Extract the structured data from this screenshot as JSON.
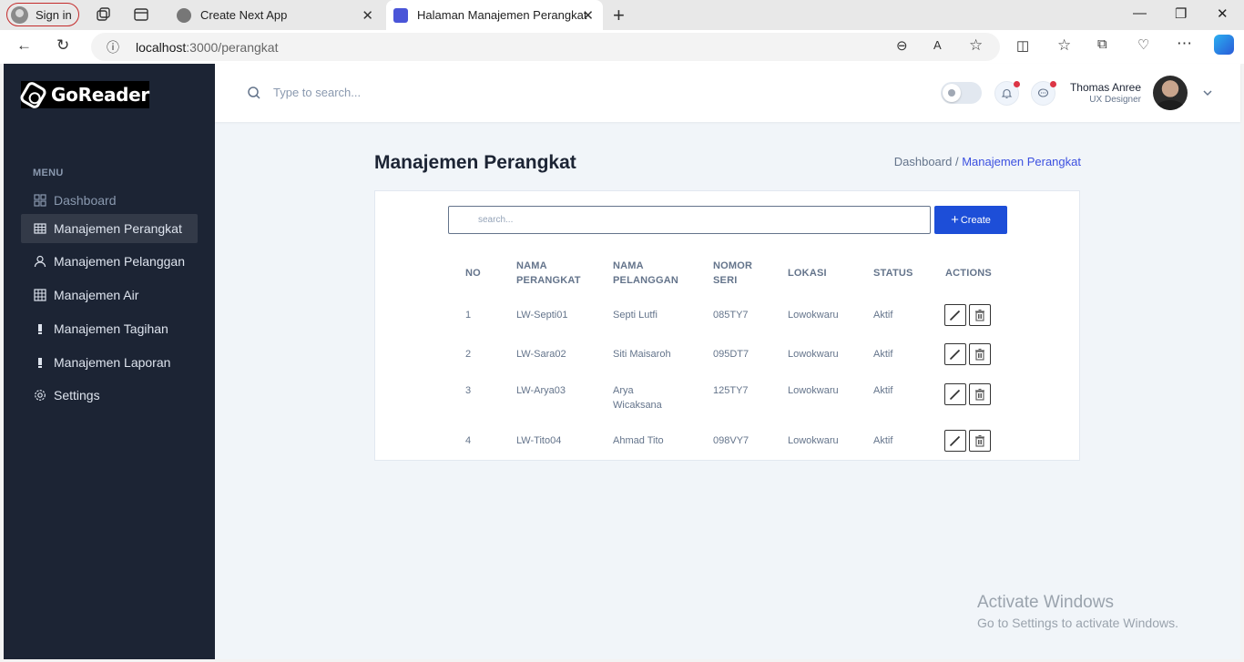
{
  "browser": {
    "signin_label": "Sign in",
    "tabs": [
      {
        "title": "Create Next App"
      },
      {
        "title": "Halaman Manajemen Perangkat"
      }
    ],
    "url_host": "localhost",
    "url_rest": ":3000/perangkat"
  },
  "sidebar": {
    "brand": "GoReader",
    "menu_title": "MENU",
    "items": [
      {
        "label": "Dashboard",
        "icon": "grid-icon"
      },
      {
        "label": "Manajemen Perangkat",
        "icon": "table-icon"
      },
      {
        "label": "Manajemen Pelanggan",
        "icon": "user-icon"
      },
      {
        "label": "Manajemen Air",
        "icon": "table-icon"
      },
      {
        "label": "Manajemen Tagihan",
        "icon": "bar-icon"
      },
      {
        "label": "Manajemen Laporan",
        "icon": "bar-icon"
      },
      {
        "label": "Settings",
        "icon": "gear-icon"
      }
    ]
  },
  "header": {
    "search_placeholder": "Type to search...",
    "user_name": "Thomas Anree",
    "user_role": "UX Designer"
  },
  "page": {
    "title": "Manajemen Perangkat",
    "breadcrumb_home": "Dashboard /",
    "breadcrumb_current": "Manajemen Perangkat"
  },
  "table": {
    "search_placeholder": "search...",
    "create_label": "Create",
    "columns": [
      "NO",
      "NAMA PERANGKAT",
      "NAMA PELANGGAN",
      "NOMOR SERI",
      "LOKASI",
      "STATUS",
      "ACTIONS"
    ],
    "rows": [
      [
        "1",
        "LW-Septi01",
        "Septi Lutfi",
        "085TY7",
        "Lowokwaru",
        "Aktif"
      ],
      [
        "2",
        "LW-Sara02",
        "Siti Maisaroh",
        "095DT7",
        "Lowokwaru",
        "Aktif"
      ],
      [
        "3",
        "LW-Arya03",
        "Arya Wicaksana",
        "125TY7",
        "Lowokwaru",
        "Aktif"
      ],
      [
        "4",
        "LW-Tito04",
        "Ahmad Tito",
        "098VY7",
        "Lowokwaru",
        "Aktif"
      ]
    ]
  },
  "watermark": {
    "line1": "Activate Windows",
    "line2": "Go to Settings to activate Windows."
  },
  "colors": {
    "sidebar_bg": "#1c2434",
    "accent": "#3c50e0",
    "create_button": "#1d4ed8"
  }
}
